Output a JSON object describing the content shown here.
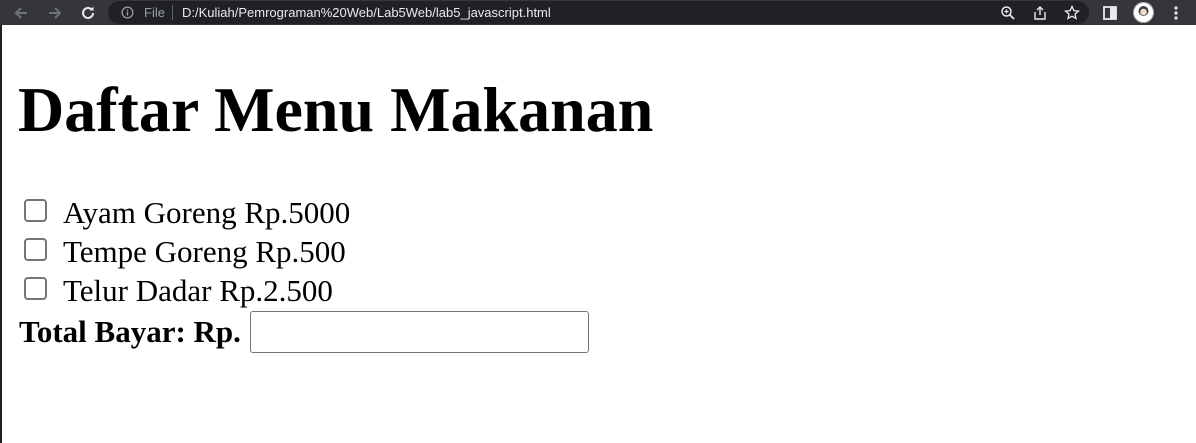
{
  "browser": {
    "file_label": "File",
    "url": "D:/Kuliah/Pemrograman%20Web/Lab5Web/lab5_javascript.html"
  },
  "page": {
    "heading": "Daftar Menu Makanan",
    "menu_items": [
      {
        "label": "Ayam Goreng Rp.5000",
        "checked": false
      },
      {
        "label": "Tempe Goreng Rp.500",
        "checked": false
      },
      {
        "label": "Telur Dadar Rp.2.500",
        "checked": false
      }
    ],
    "total_label": "Total Bayar: Rp.",
    "total_value": ""
  },
  "colors": {
    "toolbar_bg": "#35363a",
    "omnibox_bg": "#202124",
    "url_text": "#e8eaed",
    "muted_text": "#9aa0a6"
  }
}
